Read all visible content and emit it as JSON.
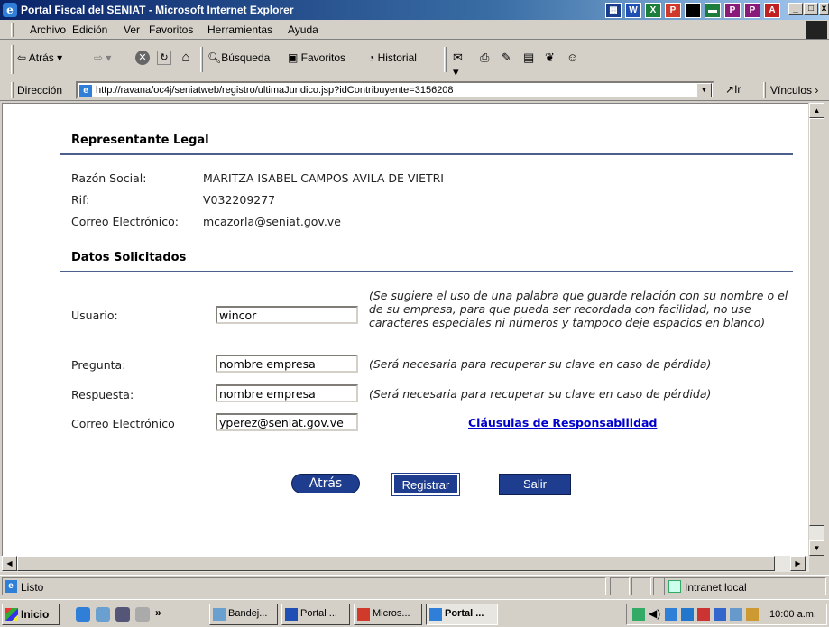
{
  "window": {
    "title": "Portal Fiscal del SENIAT - Microsoft Internet Explorer"
  },
  "menu": [
    "Archivo",
    "Edición",
    "Ver",
    "Favoritos",
    "Herramientas",
    "Ayuda"
  ],
  "toolbar": {
    "back": "Atrás",
    "search": "Búsqueda",
    "favorites": "Favoritos",
    "history": "Historial"
  },
  "address": {
    "label": "Dirección",
    "url": "http://ravana/oc4j/seniatweb/registro/ultimaJuridico.jsp?idContribuyente=3156208",
    "go": "Ir",
    "links": "Vínculos"
  },
  "page": {
    "rep_title": "Representante Legal",
    "razon_label": "Razón Social:",
    "razon_value": "MARITZA ISABEL CAMPOS AVILA DE VIETRI",
    "rif_label": "Rif:",
    "rif_value": "V032209277",
    "correo_label": "Correo Electrónico:",
    "correo_value": "mcazorla@seniat.gov.ve",
    "datos_title": "Datos Solicitados",
    "usuario_label": "Usuario:",
    "usuario_value": "wincor",
    "usuario_hint": "(Se sugiere el uso de una palabra que guarde relación con su nombre o el de su empresa, para que pueda ser recordada con facilidad, no use caracteres especiales ni números y tampoco deje espacios en blanco)",
    "pregunta_label": "Pregunta:",
    "pregunta_value": "nombre empresa",
    "pregunta_hint": "(Será necesaria para recuperar su clave en caso de pérdida)",
    "respuesta_label": "Respuesta:",
    "respuesta_value": "nombre empresa",
    "respuesta_hint": "(Será necesaria para recuperar su clave en caso de pérdida)",
    "correo2_label": "Correo Electrónico",
    "correo2_value": "yperez@seniat.gov.ve",
    "clausulas_link": "Cláusulas de Responsabilidad",
    "btn_atras": "Atrás",
    "btn_registrar": "Registrar",
    "btn_salir": "Salir"
  },
  "status": {
    "text": "Listo",
    "zone": "Intranet local"
  },
  "taskbar": {
    "start": "Inicio",
    "tasks": [
      "Bandej...",
      "Portal ...",
      "Micros...",
      "Portal ..."
    ],
    "clock": "10:00 a.m."
  },
  "colors": {
    "title_blue": "#0a246a",
    "button_blue": "#1f3d8f",
    "rule": "#4c5e8c",
    "link": "#0000cc"
  }
}
